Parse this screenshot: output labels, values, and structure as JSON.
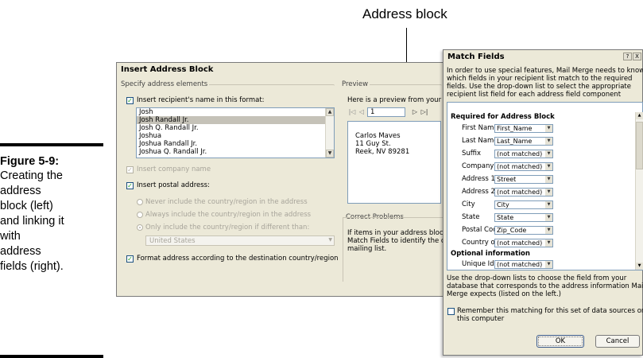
{
  "caption": {
    "figure": "Figure 5-9:",
    "body_lines": [
      "Creating the",
      "address",
      "block (left)",
      "and linking it",
      "with",
      "address",
      "fields (right)."
    ]
  },
  "callout": "Address block",
  "insert_dialog": {
    "title": "Insert Address Block",
    "specify_group": "Specify address elements",
    "recipient_name_label": "Insert recipient's name in this format:",
    "name_formats": [
      "Josh",
      "Josh Randall Jr.",
      "Josh Q. Randall Jr.",
      "Joshua",
      "Joshua Randall Jr.",
      "Joshua Q. Randall Jr."
    ],
    "selected_format": "Josh Randall Jr.",
    "company_label": "Insert company name",
    "postal_label": "Insert postal address:",
    "radio_never": "Never include the country/region in the address",
    "radio_always": "Always include the country/region in the address",
    "radio_only": "Only include the country/region if different than:",
    "country_value": "United States",
    "format_label": "Format address according to the destination country/region",
    "preview_group": "Preview",
    "preview_text": "Here is a preview from your",
    "record_number": "1",
    "preview_address": [
      "Carlos Maves",
      "11 Guy St.",
      "Reek, NV 89281"
    ],
    "correct_group": "Correct Problems",
    "correct_text": [
      "If items in your address bloc",
      "Match Fields to identify the c",
      "mailing list."
    ]
  },
  "match_dialog": {
    "title": "Match Fields",
    "intro": [
      "In order to use special features, Mail Merge needs to know",
      "which fields in your recipient list match to the required",
      "fields.  Use the drop-down list to select the appropriate",
      "recipient list field for each address field component"
    ],
    "required_header": "Required for Address Block",
    "fields": [
      {
        "label": "First Name",
        "value": "First_Name"
      },
      {
        "label": "Last Name",
        "value": "Last_Name"
      },
      {
        "label": "Suffix",
        "value": "(not matched)"
      },
      {
        "label": "Company",
        "value": "(not matched)"
      },
      {
        "label": "Address 1",
        "value": "Street"
      },
      {
        "label": "Address 2",
        "value": "(not matched)"
      },
      {
        "label": "City",
        "value": "City"
      },
      {
        "label": "State",
        "value": "State"
      },
      {
        "label": "Postal Code",
        "value": "Zip_Code"
      },
      {
        "label": "Country or Region",
        "value": "(not matched)"
      }
    ],
    "optional_header": "Optional information",
    "unique_label": "Unique Identifier",
    "unique_value": "(not matched)",
    "footer": [
      "Use the drop-down lists to choose the field from your",
      "database that corresponds to the address information Mail",
      "Merge expects (listed on the left.)"
    ],
    "remember_label": [
      "Remember this matching for this set of data sources on",
      "this computer"
    ],
    "ok": "OK",
    "cancel": "Cancel",
    "help_btn": "?",
    "close_btn": "X"
  }
}
